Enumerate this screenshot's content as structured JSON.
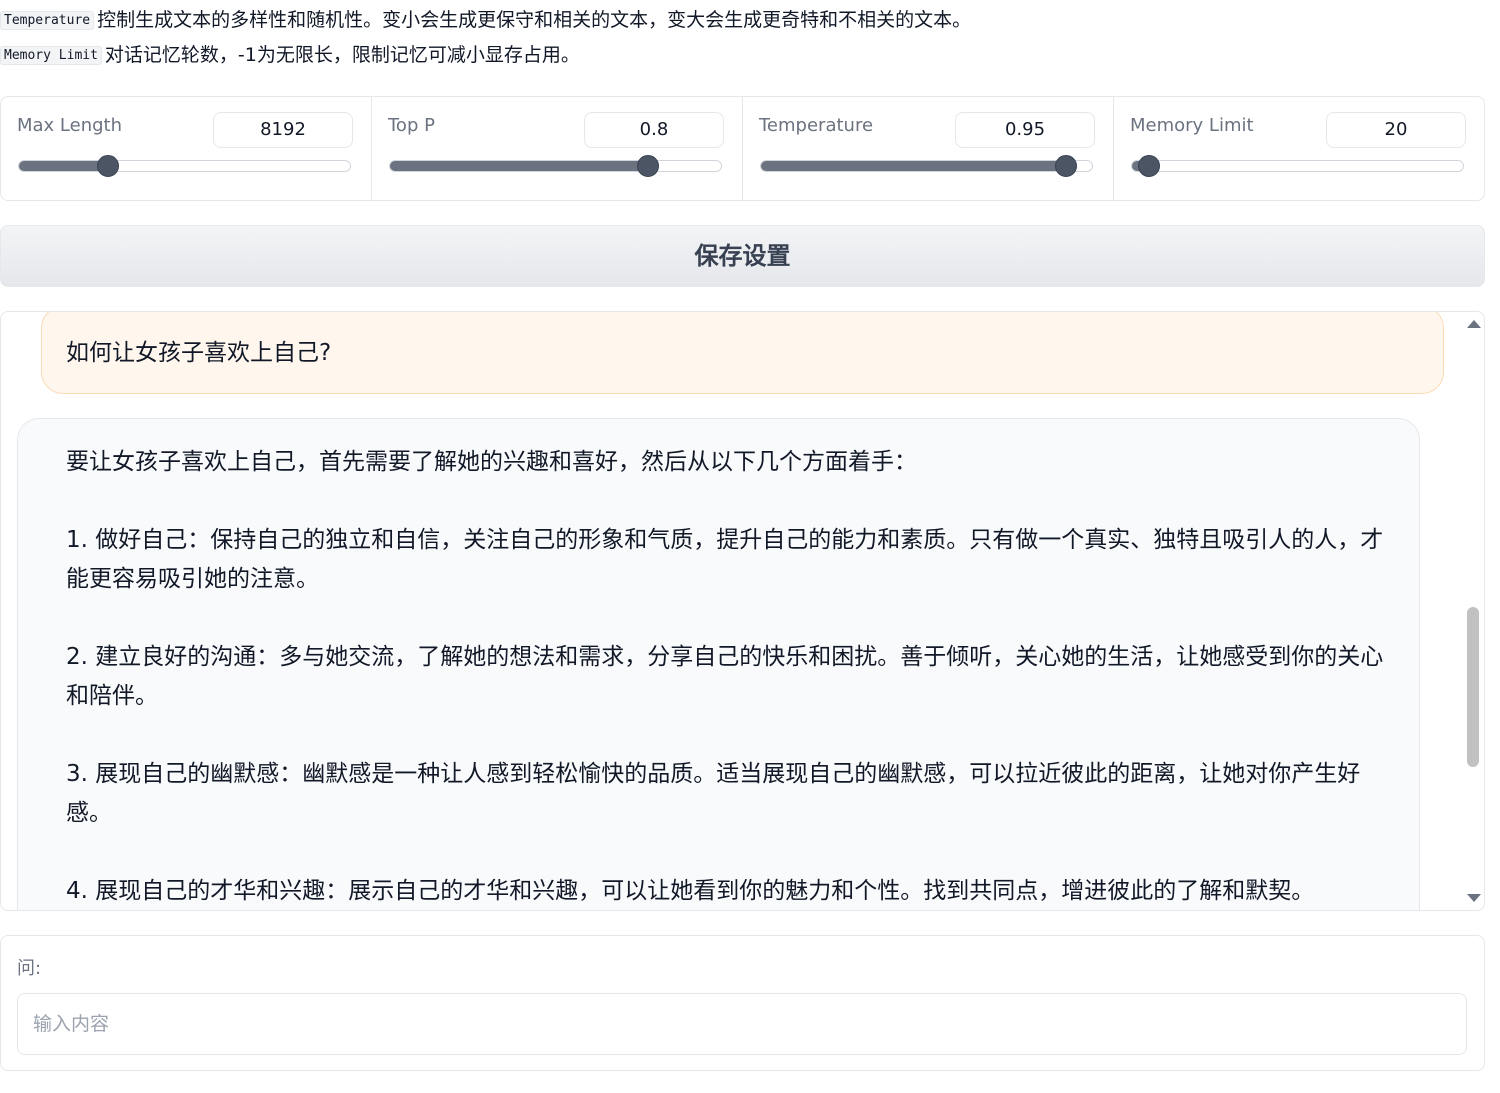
{
  "help": [
    {
      "code": "Temperature",
      "text": "控制生成文本的多样性和随机性。变小会生成更保守和相关的文本，变大会生成更奇特和不相关的文本。"
    },
    {
      "code": "Memory Limit",
      "text": "对话记忆轮数，-1为无限长，限制记忆可减小显存占用。"
    }
  ],
  "sliders": [
    {
      "label": "Max Length",
      "value": "8192",
      "fraction": 0.27
    },
    {
      "label": "Top P",
      "value": "0.8",
      "fraction": 0.78
    },
    {
      "label": "Temperature",
      "value": "0.95",
      "fraction": 0.92
    },
    {
      "label": "Memory Limit",
      "value": "20",
      "fraction": 0.05
    }
  ],
  "save_button": "保存设置",
  "chat": {
    "user_message": "如何让女孩子喜欢上自己?",
    "bot_paragraphs": [
      "要让女孩子喜欢上自己，首先需要了解她的兴趣和喜好，然后从以下几个方面着手：",
      "1. 做好自己：保持自己的独立和自信，关注自己的形象和气质，提升自己的能力和素质。只有做一个真实、独特且吸引人的人，才能更容易吸引她的注意。",
      "2. 建立良好的沟通：多与她交流，了解她的想法和需求，分享自己的快乐和困扰。善于倾听，关心她的生活，让她感受到你的关心和陪伴。",
      "3. 展现自己的幽默感：幽默感是一种让人感到轻松愉快的品质。适当展现自己的幽默感，可以拉近彼此的距离，让她对你产生好感。",
      "4. 展现自己的才华和兴趣：展示自己的才华和兴趣，可以让她看到你的魅力和个性。找到共同点，增进彼此的了解和默契。"
    ]
  },
  "input": {
    "label": "问:",
    "placeholder": "输入内容"
  }
}
